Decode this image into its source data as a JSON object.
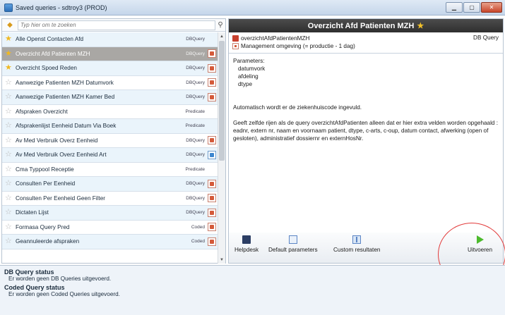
{
  "window": {
    "title": "Saved queries - sdtroy3 (PROD)"
  },
  "search": {
    "placeholder": "Typ hier om te zoeken"
  },
  "queries": [
    {
      "name": "Alle Openst Contacten Afd",
      "type": "DBQuery",
      "starred": true,
      "icon": ""
    },
    {
      "name": "Overzicht Afd Patienten MZH",
      "type": "DBQuery",
      "starred": true,
      "icon": "pdf",
      "selected": true
    },
    {
      "name": "Overzicht Spoed Reden",
      "type": "DBQuery",
      "starred": true,
      "icon": "pdf"
    },
    {
      "name": "Aanwezige Patienten MZH Datumvork",
      "type": "DBQuery",
      "starred": false,
      "icon": "pdf"
    },
    {
      "name": "Aanwezige Patienten MZH Kamer Bed",
      "type": "DBQuery",
      "starred": false,
      "icon": "pdf"
    },
    {
      "name": "Afspraken Overzicht",
      "type": "Predicate",
      "starred": false,
      "icon": ""
    },
    {
      "name": "Afsprakenlijst Eenheid Datum Via Boek",
      "type": "Predicate",
      "starred": false,
      "icon": ""
    },
    {
      "name": "Av Med Verbruik Overz Eenheid",
      "type": "DBQuery",
      "starred": false,
      "icon": "pdf"
    },
    {
      "name": "Av Med Verbruik Overz Eenheid Art",
      "type": "DBQuery",
      "starred": false,
      "icon": "blue"
    },
    {
      "name": "Cma Typpool Receptie",
      "type": "Predicate",
      "starred": false,
      "icon": ""
    },
    {
      "name": "Consulten Per Eenheid",
      "type": "DBQuery",
      "starred": false,
      "icon": "pdf"
    },
    {
      "name": "Consulten Per Eenheid Geen Filter",
      "type": "DBQuery",
      "starred": false,
      "icon": "pdf"
    },
    {
      "name": "Dictaten Lijst",
      "type": "DBQuery",
      "starred": false,
      "icon": "pdf"
    },
    {
      "name": "Formasa Query Pred",
      "type": "Coded",
      "starred": false,
      "icon": "pdf"
    },
    {
      "name": "Geannuleerde afspraken",
      "type": "Coded",
      "starred": false,
      "icon": "pdf"
    }
  ],
  "detail": {
    "header": "Overzicht Afd Patienten MZH",
    "query_id": "overzichtAfdPatientenMZH",
    "environment": "Management omgeving (= productie - 1 dag)",
    "query_type": "DB Query",
    "parameters_label": "Parameters:",
    "parameters": [
      "datumvork",
      "afdeling",
      "dtype"
    ],
    "note": "Automatisch wordt er de ziekenhuiscode ingevuld.",
    "description": "Geeft zelfde rijen als de query overzichtAfdPatienten alleen dat er hier extra velden worden opgehaald : eadnr, extern nr, naam en voornaam patient, dtype, c-arts, c-oup, datum contact, afwerking (open of gesloten), administratief dossiernr en externHosNr."
  },
  "toolbar": {
    "helpdesk": "Helpdesk",
    "default_parameters": "Default parameters",
    "custom_resultaten": "Custom resultaten",
    "uitvoeren": "Uitvoeren"
  },
  "status": {
    "db_title": "DB Query status",
    "db_text": "Er worden geen DB Queries uitgevoerd.",
    "coded_title": "Coded Query status",
    "coded_text": "Er worden geen Coded Queries uitgevoerd."
  },
  "colors": {
    "header_bg": "#3a3a3a",
    "selected_row": "#a9a7a4",
    "alt_row": "#eaf4fb",
    "callout": "#e23a3a",
    "play": "#4cba2c"
  }
}
